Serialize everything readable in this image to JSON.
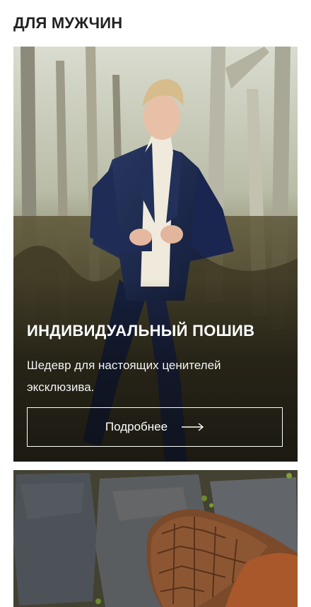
{
  "section": {
    "title": "ДЛЯ МУЖЧИН"
  },
  "cards": [
    {
      "title": "ИНДИВИДУАЛЬНЫЙ ПОШИВ",
      "description": "Шедевр для настоящих ценителей эксклюзива.",
      "button_label": "Подробнее",
      "button_icon": "arrow-right-icon",
      "image": "man-in-navy-suit-photo"
    },
    {
      "image": "crocodile-leather-shoe-photo"
    }
  ],
  "colors": {
    "title_text": "#222222",
    "overlay_text": "#ffffff",
    "suit": "#1c2a4e",
    "sweater": "#efeadb",
    "shoe_leather": "#a8582a"
  }
}
